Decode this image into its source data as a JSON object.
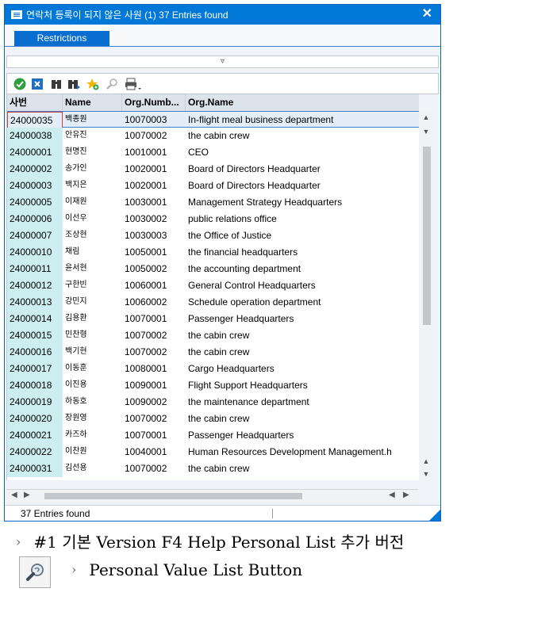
{
  "window": {
    "title": "연락처 등록이 되지 않은 사원 (1)   37 Entries found",
    "close": "✕"
  },
  "tabs": [
    {
      "label": "Restrictions"
    }
  ],
  "collapse_arrow": "▿",
  "toolbar": {
    "icons": [
      "check-icon",
      "cancel-icon",
      "find-icon",
      "find-next-icon",
      "add-favorite-icon",
      "personal-list-icon",
      "print-icon"
    ]
  },
  "table": {
    "columns": [
      "사번",
      "Name",
      "Org.Numb...",
      "Org.Name"
    ],
    "rows": [
      [
        "24000035",
        "백종원",
        "10070003",
        "In-flight meal business department"
      ],
      [
        "24000038",
        "안유진",
        "10070002",
        "the cabin crew"
      ],
      [
        "24000001",
        "현명진",
        "10010001",
        "CEO"
      ],
      [
        "24000002",
        "송가인",
        "10020001",
        "Board of Directors Headquarter"
      ],
      [
        "24000003",
        "백지은",
        "10020001",
        "Board of Directors Headquarter"
      ],
      [
        "24000005",
        "이재원",
        "10030001",
        "Management Strategy Headquarters"
      ],
      [
        "24000006",
        "이선우",
        "10030002",
        "public relations office"
      ],
      [
        "24000007",
        "조상현",
        "10030003",
        "the Office of Justice"
      ],
      [
        "24000010",
        "채림",
        "10050001",
        "the financial headquarters"
      ],
      [
        "24000011",
        "윤서현",
        "10050002",
        "the accounting department"
      ],
      [
        "24000012",
        "구한빈",
        "10060001",
        "General Control Headquarters"
      ],
      [
        "24000013",
        "강민지",
        "10060002",
        "Schedule operation department"
      ],
      [
        "24000014",
        "김용환",
        "10070001",
        "Passenger Headquarters"
      ],
      [
        "24000015",
        "민찬형",
        "10070002",
        "the cabin crew"
      ],
      [
        "24000016",
        "백기현",
        "10070002",
        "the cabin crew"
      ],
      [
        "24000017",
        "이동훈",
        "10080001",
        "Cargo Headquarters"
      ],
      [
        "24000018",
        "이진용",
        "10090001",
        "Flight Support Headquarters"
      ],
      [
        "24000019",
        "하동호",
        "10090002",
        "the maintenance department"
      ],
      [
        "24000020",
        "장원영",
        "10070002",
        "the cabin crew"
      ],
      [
        "24000021",
        "카즈하",
        "10070001",
        "Passenger Headquarters"
      ],
      [
        "24000022",
        "이찬원",
        "10040001",
        "Human Resources Development Management.h"
      ],
      [
        "24000031",
        "김선용",
        "10070002",
        "the cabin crew"
      ]
    ],
    "selected_row": 0
  },
  "status": {
    "text": "37 Entries found"
  },
  "notes": {
    "bullet1": "#1 기본 Version F4 Help Personal List 추가 버전",
    "bullet2": "Personal Value List Button",
    "chevron": "›"
  },
  "colors": {
    "accent": "#0078d7",
    "key_column": "#cdeef0"
  }
}
